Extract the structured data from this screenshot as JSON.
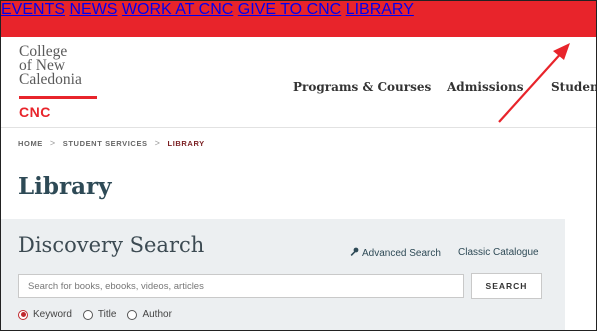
{
  "top_nav": {
    "events": "EVENTS",
    "news": "NEWS",
    "work": "WORK AT CNC",
    "give": "GIVE TO CNC",
    "library": "LIBRARY"
  },
  "logo": {
    "line1": "College",
    "line2": "of New",
    "line3": "Caledonia",
    "abbr": "CNC"
  },
  "main_nav": {
    "programs": "Programs & Courses",
    "admissions": "Admissions",
    "students": "Students"
  },
  "breadcrumb": {
    "home": "HOME",
    "sep": ">",
    "student_services": "STUDENT SERVICES",
    "library": "LIBRARY"
  },
  "page_title": "Library",
  "discovery": {
    "title": "Discovery Search",
    "advanced": "Advanced Search",
    "classic": "Classic Catalogue",
    "placeholder": "Search for books, ebooks, videos, articles",
    "search_button": "SEARCH",
    "options": [
      "Keyword",
      "Title",
      "Author"
    ],
    "selected": "Keyword"
  },
  "colors": {
    "brand_red": "#e8242b",
    "title_blue": "#2e4a56",
    "annotation_arrow": "#e8242b"
  },
  "icons": {
    "advanced": "key-icon"
  }
}
